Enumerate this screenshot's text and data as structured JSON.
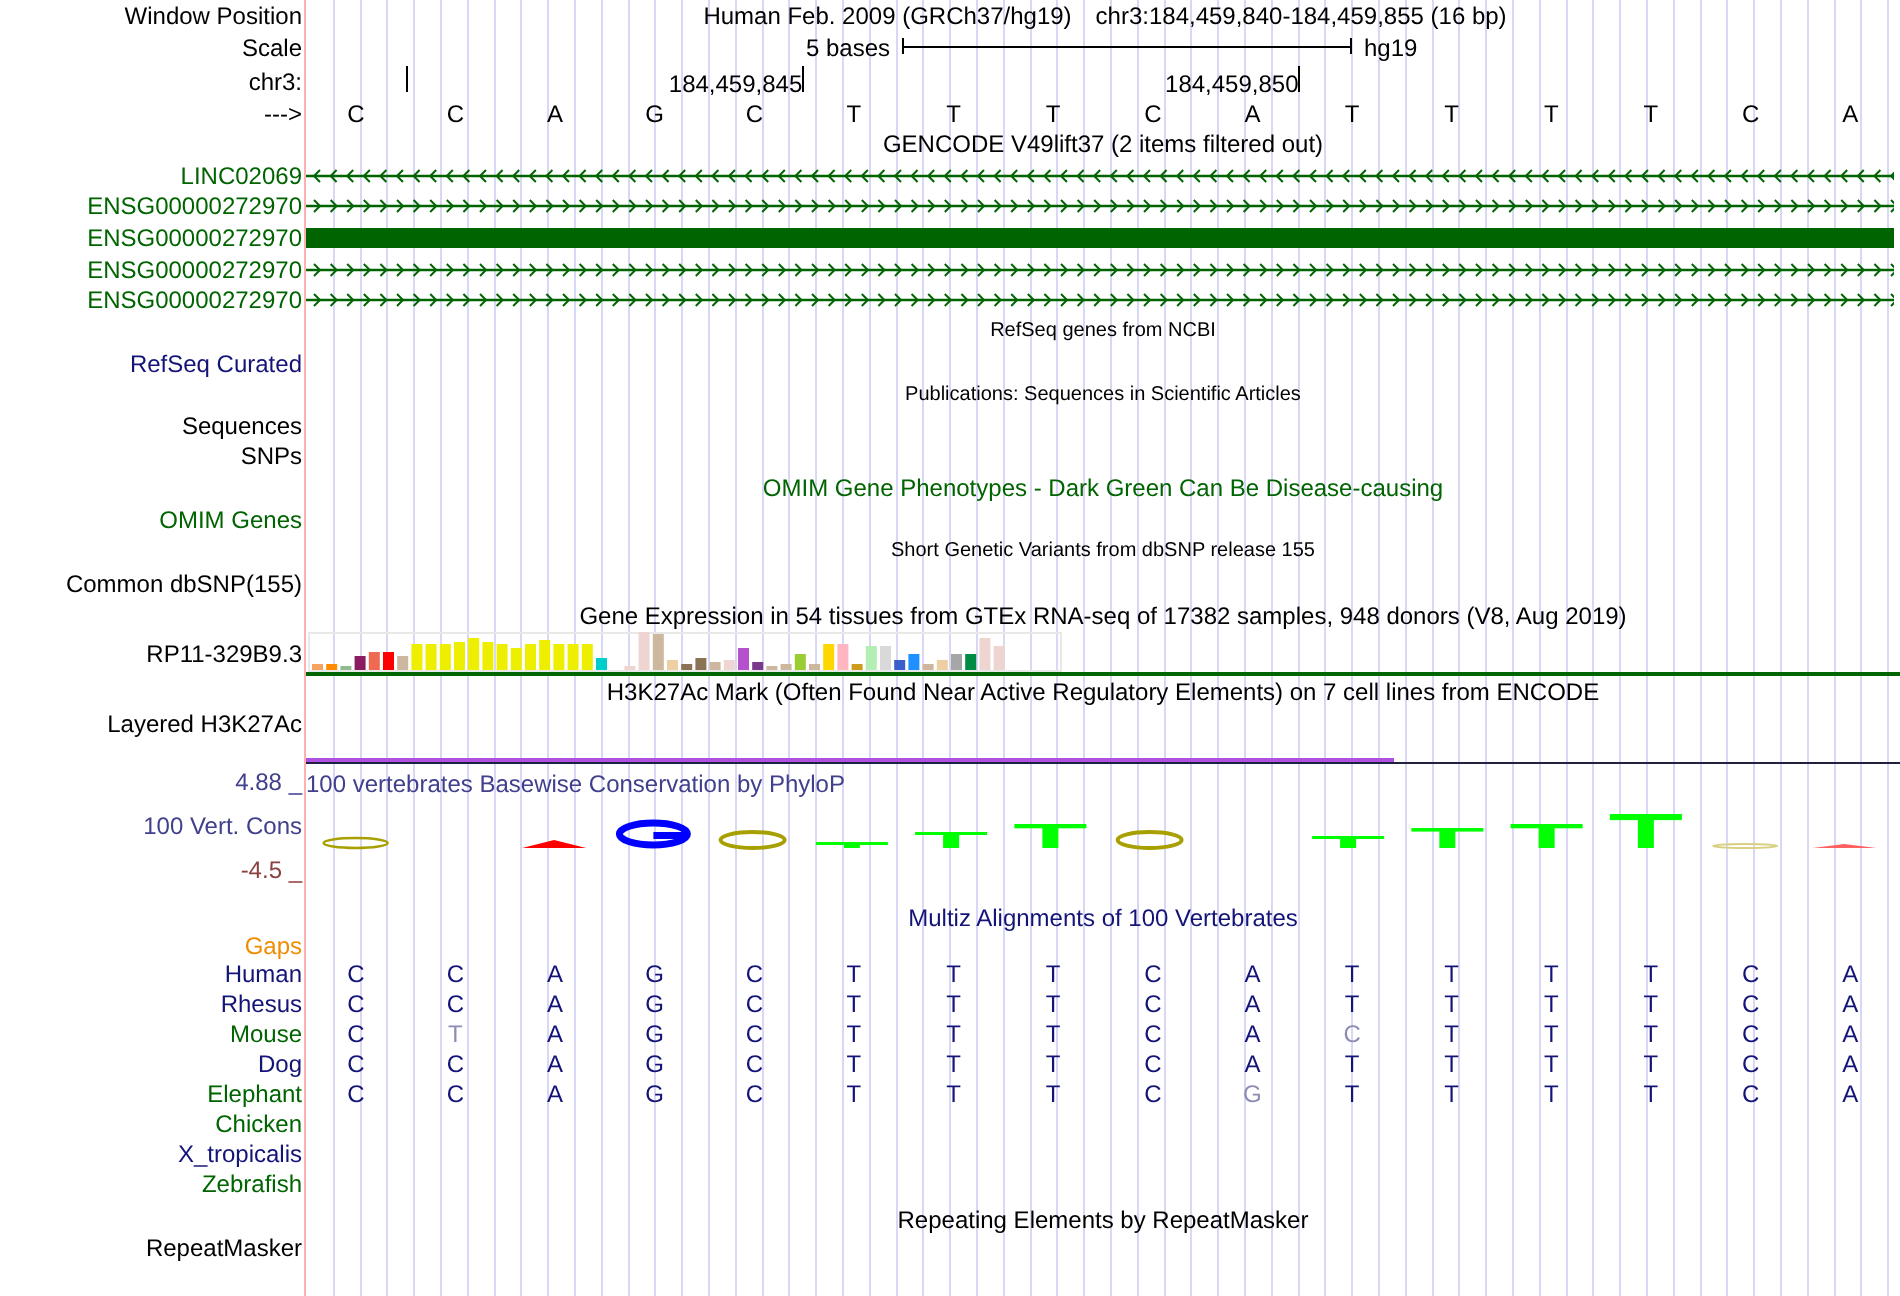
{
  "ruler": {
    "window_label": "Window Position",
    "assembly": "Human Feb. 2009 (GRCh37/hg19)",
    "position": "chr3:184,459,840-184,459,855 (16 bp)",
    "scale_label": "Scale",
    "scale_text": "5 bases",
    "scale_db": "hg19",
    "chrom_label": "chr3:",
    "ticks": [
      "184,459,845",
      "184,459,850"
    ],
    "strand_label": "--->",
    "bases": [
      "C",
      "C",
      "A",
      "G",
      "C",
      "T",
      "T",
      "T",
      "C",
      "A",
      "T",
      "T",
      "T",
      "T",
      "C",
      "A"
    ]
  },
  "gencode": {
    "title": "GENCODE V49lift37 (2 items filtered out)",
    "genes": [
      {
        "name": "LINC02069",
        "kind": "minus"
      },
      {
        "name": "ENSG00000272970",
        "kind": "plus"
      },
      {
        "name": "ENSG00000272970",
        "kind": "block"
      },
      {
        "name": "ENSG00000272970",
        "kind": "plus"
      },
      {
        "name": "ENSG00000272970",
        "kind": "plus"
      }
    ]
  },
  "refseq": {
    "title": "RefSeq genes from NCBI",
    "label": "RefSeq Curated"
  },
  "publications": {
    "title": "Publications: Sequences in Scientific Articles",
    "labels": [
      "Sequences",
      "SNPs"
    ]
  },
  "omim": {
    "title": "OMIM Gene Phenotypes - Dark Green Can Be Disease-causing",
    "label": "OMIM Genes"
  },
  "dbsnp": {
    "title": "Short Genetic Variants from dbSNP release 155",
    "label": "Common dbSNP(155)"
  },
  "gtex": {
    "title": "Gene Expression in 54 tissues from GTEx RNA-seq of 17382 samples, 948 donors (V8, Aug 2019)",
    "label": "RP11-329B9.3"
  },
  "h3k27ac": {
    "title": "H3K27Ac Mark (Often Found Near Active Regulatory Elements) on 7 cell lines from ENCODE",
    "label": "Layered H3K27Ac"
  },
  "phylop": {
    "title": "100 vertebrates Basewise Conservation by PhyloP",
    "label": "100 Vert. Cons",
    "max": "4.88 _",
    "min": "-4.5 _"
  },
  "multiz": {
    "title": "Multiz Alignments of 100 Vertebrates",
    "gaps_label": "Gaps",
    "species": [
      {
        "name": "Human",
        "color": "#141478",
        "bases": [
          {
            "base": "C",
            "differs": false
          },
          {
            "base": "C",
            "differs": false
          },
          {
            "base": "A",
            "differs": false
          },
          {
            "base": "G",
            "differs": false
          },
          {
            "base": "C",
            "differs": false
          },
          {
            "base": "T",
            "differs": false
          },
          {
            "base": "T",
            "differs": false
          },
          {
            "base": "T",
            "differs": false
          },
          {
            "base": "C",
            "differs": false
          },
          {
            "base": "A",
            "differs": false
          },
          {
            "base": "T",
            "differs": false
          },
          {
            "base": "T",
            "differs": false
          },
          {
            "base": "T",
            "differs": false
          },
          {
            "base": "T",
            "differs": false
          },
          {
            "base": "C",
            "differs": false
          },
          {
            "base": "A",
            "differs": false
          }
        ]
      },
      {
        "name": "Rhesus",
        "color": "#141478",
        "bases": [
          {
            "base": "C",
            "differs": false
          },
          {
            "base": "C",
            "differs": false
          },
          {
            "base": "A",
            "differs": false
          },
          {
            "base": "G",
            "differs": false
          },
          {
            "base": "C",
            "differs": false
          },
          {
            "base": "T",
            "differs": false
          },
          {
            "base": "T",
            "differs": false
          },
          {
            "base": "T",
            "differs": false
          },
          {
            "base": "C",
            "differs": false
          },
          {
            "base": "A",
            "differs": false
          },
          {
            "base": "T",
            "differs": false
          },
          {
            "base": "T",
            "differs": false
          },
          {
            "base": "T",
            "differs": false
          },
          {
            "base": "T",
            "differs": false
          },
          {
            "base": "C",
            "differs": false
          },
          {
            "base": "A",
            "differs": false
          }
        ]
      },
      {
        "name": "Mouse",
        "color": "#006400",
        "bases": [
          {
            "base": "C",
            "differs": false
          },
          {
            "base": "T",
            "differs": true
          },
          {
            "base": "A",
            "differs": false
          },
          {
            "base": "G",
            "differs": false
          },
          {
            "base": "C",
            "differs": false
          },
          {
            "base": "T",
            "differs": false
          },
          {
            "base": "T",
            "differs": false
          },
          {
            "base": "T",
            "differs": false
          },
          {
            "base": "C",
            "differs": false
          },
          {
            "base": "A",
            "differs": false
          },
          {
            "base": "C",
            "differs": true
          },
          {
            "base": "T",
            "differs": false
          },
          {
            "base": "T",
            "differs": false
          },
          {
            "base": "T",
            "differs": false
          },
          {
            "base": "C",
            "differs": false
          },
          {
            "base": "A",
            "differs": false
          }
        ]
      },
      {
        "name": "Dog",
        "color": "#141478",
        "bases": [
          {
            "base": "C",
            "differs": false
          },
          {
            "base": "C",
            "differs": false
          },
          {
            "base": "A",
            "differs": false
          },
          {
            "base": "G",
            "differs": false
          },
          {
            "base": "C",
            "differs": false
          },
          {
            "base": "T",
            "differs": false
          },
          {
            "base": "T",
            "differs": false
          },
          {
            "base": "T",
            "differs": false
          },
          {
            "base": "C",
            "differs": false
          },
          {
            "base": "A",
            "differs": false
          },
          {
            "base": "T",
            "differs": false
          },
          {
            "base": "T",
            "differs": false
          },
          {
            "base": "T",
            "differs": false
          },
          {
            "base": "T",
            "differs": false
          },
          {
            "base": "C",
            "differs": false
          },
          {
            "base": "A",
            "differs": false
          }
        ]
      },
      {
        "name": "Elephant",
        "color": "#006400",
        "bases": [
          {
            "base": "C",
            "differs": false
          },
          {
            "base": "C",
            "differs": false
          },
          {
            "base": "A",
            "differs": false
          },
          {
            "base": "G",
            "differs": false
          },
          {
            "base": "C",
            "differs": false
          },
          {
            "base": "T",
            "differs": false
          },
          {
            "base": "T",
            "differs": false
          },
          {
            "base": "T",
            "differs": false
          },
          {
            "base": "C",
            "differs": false
          },
          {
            "base": "G",
            "differs": true
          },
          {
            "base": "T",
            "differs": false
          },
          {
            "base": "T",
            "differs": false
          },
          {
            "base": "T",
            "differs": false
          },
          {
            "base": "T",
            "differs": false
          },
          {
            "base": "C",
            "differs": false
          },
          {
            "base": "A",
            "differs": false
          }
        ]
      },
      {
        "name": "Chicken",
        "color": "#006400"
      },
      {
        "name": "X_tropicalis",
        "color": "#141478"
      },
      {
        "name": "Zebrafish",
        "color": "#006400"
      }
    ]
  },
  "repeats": {
    "title": "Repeating Elements by RepeatMasker",
    "label": "RepeatMasker"
  }
}
